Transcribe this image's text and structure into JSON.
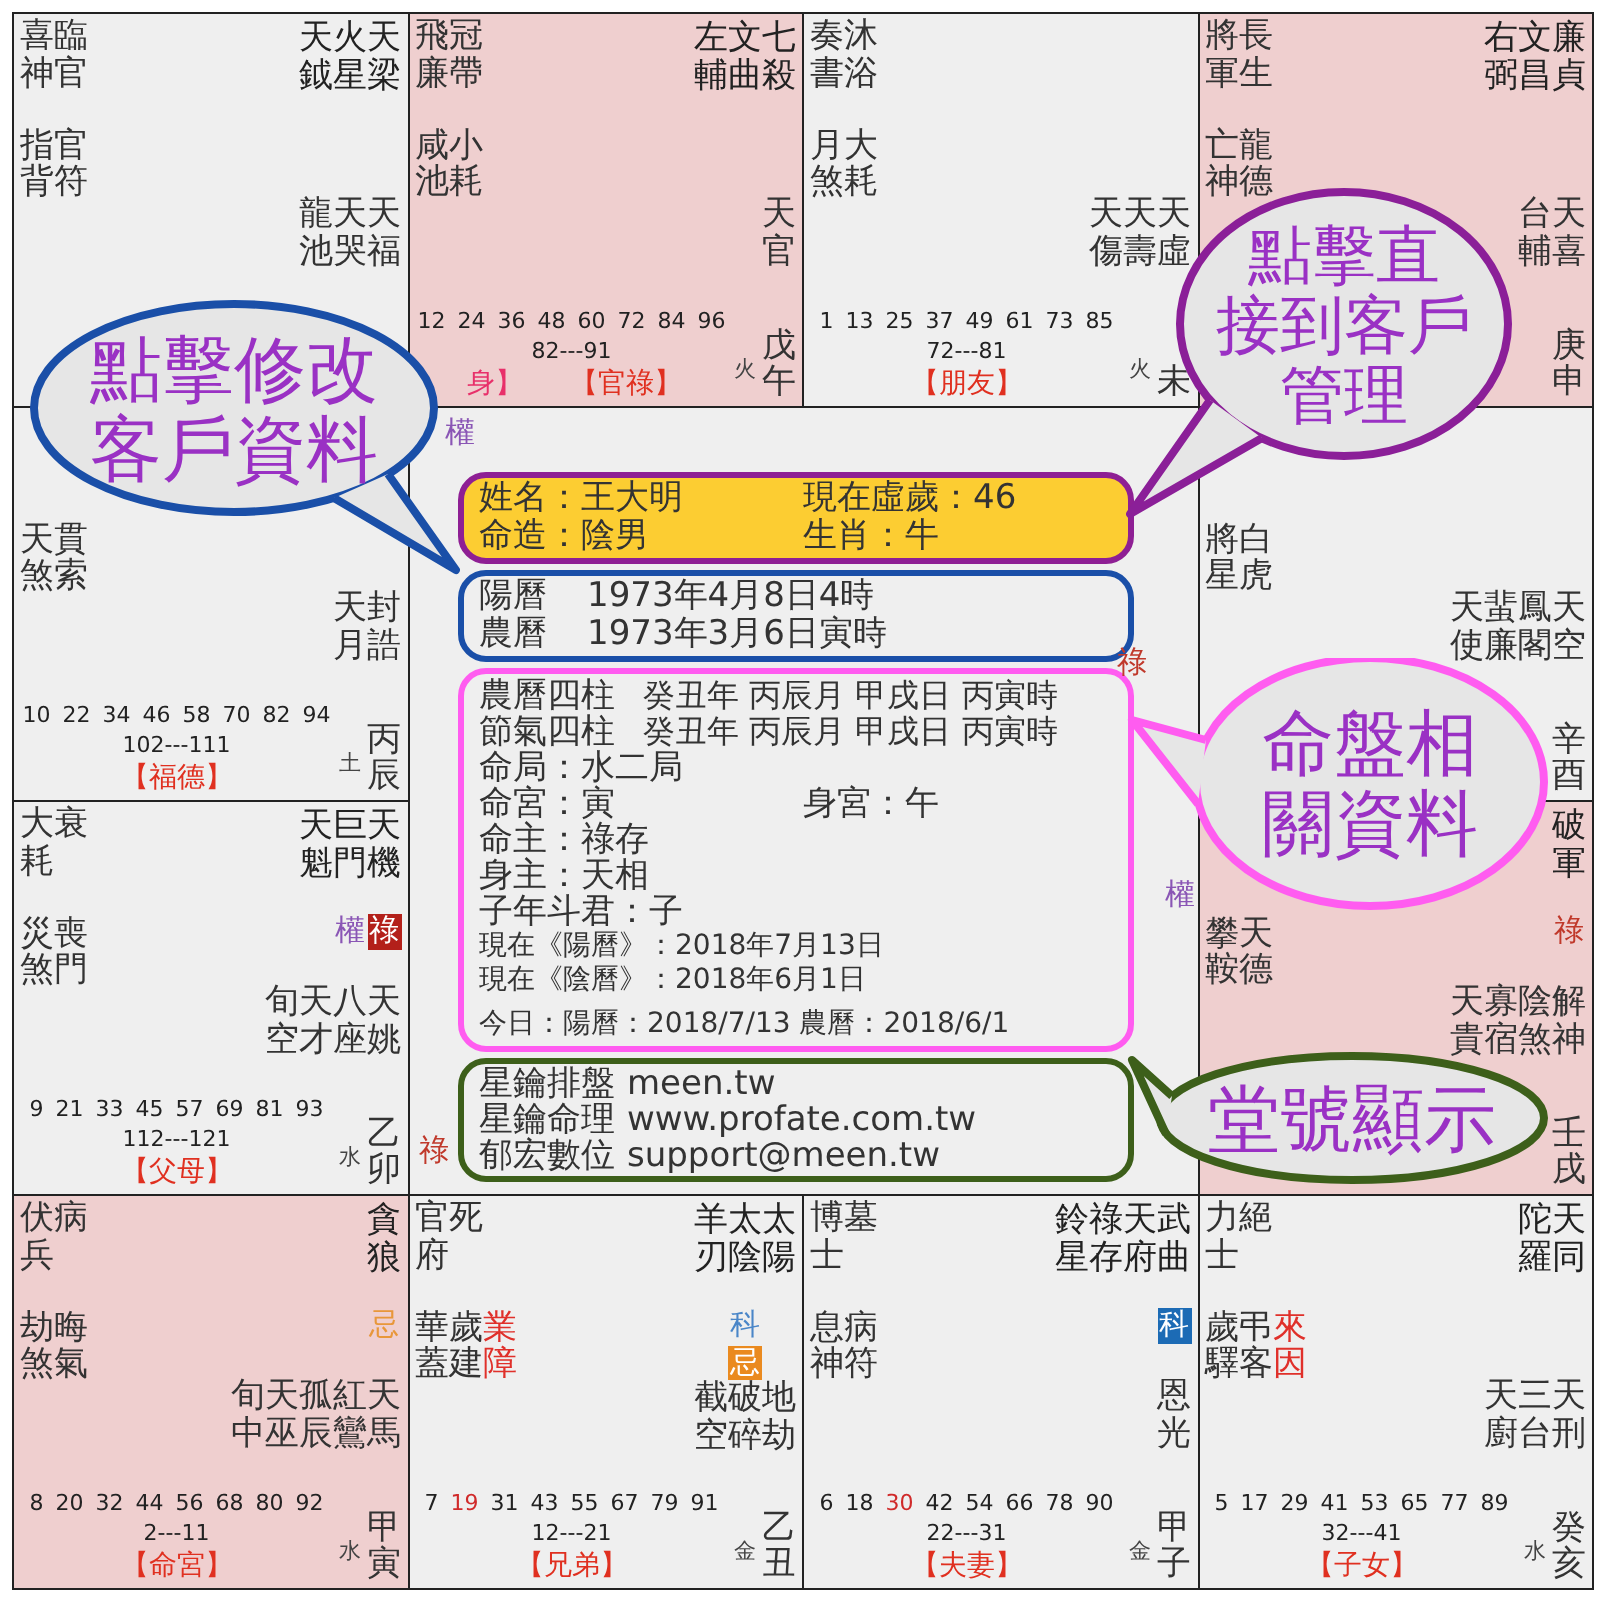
{
  "palaces": [
    {
      "highlighted": false,
      "minor_groups": [
        {
          "stars": [
            "喜神",
            "臨官"
          ]
        },
        {
          "stars": [
            "指背",
            "官符"
          ]
        }
      ],
      "main_stars": [
        {
          "name": "天鉞"
        },
        {
          "name": "火星"
        },
        {
          "name": "天梁"
        }
      ],
      "other_stars": [
        "龍池",
        "天哭",
        "天福"
      ]
    },
    {
      "highlighted": true,
      "minor_groups": [
        {
          "stars": [
            "飛廉",
            "冠帶"
          ]
        },
        {
          "stars": [
            "咸池",
            "小耗"
          ]
        }
      ],
      "main_stars": [
        {
          "name": "左輔"
        },
        {
          "name": "文曲"
        },
        {
          "name": "七殺"
        }
      ],
      "other_stars": [
        "天官"
      ],
      "ages": [
        "12",
        "24",
        "36",
        "48",
        "60",
        "72",
        "84",
        "96"
      ],
      "decade": "82---91",
      "body_mark": "身】",
      "name": "【官祿】",
      "element": "火",
      "stem_branch": "戊午"
    },
    {
      "highlighted": false,
      "minor_groups": [
        {
          "stars": [
            "奏書",
            "沐浴"
          ]
        },
        {
          "stars": [
            "月煞",
            "大耗"
          ]
        }
      ],
      "other_stars": [
        "天傷",
        "天壽",
        "天虛"
      ],
      "ages": [
        "1",
        "13",
        "25",
        "37",
        "49",
        "61",
        "73",
        "85"
      ],
      "decade": "72---81",
      "name": "【朋友】",
      "element": "火",
      "stem_branch": "未"
    },
    {
      "highlighted": true,
      "minor_groups": [
        {
          "stars": [
            "將軍",
            "長生"
          ]
        },
        {
          "stars": [
            "亡神",
            "龍德"
          ]
        }
      ],
      "main_stars": [
        {
          "name": "右弼"
        },
        {
          "name": "文昌"
        },
        {
          "name": "廉貞"
        }
      ],
      "other_stars": [
        "台輔",
        "天喜"
      ],
      "stem_branch": "庚申"
    },
    {
      "highlighted": false,
      "minor_groups": [
        {
          "stars": [
            "天煞",
            "貫索"
          ]
        }
      ],
      "other_stars": [
        "天月",
        "封誥"
      ],
      "ages": [
        "10",
        "22",
        "34",
        "46",
        "58",
        "70",
        "82",
        "94"
      ],
      "decade": "102---111",
      "name": "【福德】",
      "element": "土",
      "stem_branch": "丙辰"
    },
    {
      "highlighted": false,
      "minor_groups": [
        {
          "stars": [
            "將星",
            "白虎"
          ]
        }
      ],
      "other_stars": [
        "天使",
        "蜚廉",
        "鳳閣",
        "天空"
      ],
      "stem_branch": "辛酉"
    },
    {
      "highlighted": false,
      "minor_groups": [
        {
          "stars": [
            "大耗",
            "衰"
          ]
        },
        {
          "stars": [
            "災煞",
            "喪門"
          ]
        }
      ],
      "main_stars": [
        {
          "name": "天魁"
        },
        {
          "name": "巨門",
          "hua": [
            {
              "text": "權",
              "kind": "plain",
              "color": "#8a56b5"
            }
          ]
        },
        {
          "name": "天機",
          "hua": [
            {
              "text": "祿",
              "kind": "badge",
              "color": "#b3201a"
            }
          ]
        }
      ],
      "other_stars": [
        "旬空",
        "天才",
        "八座",
        "天姚"
      ],
      "ages": [
        "9",
        "21",
        "33",
        "45",
        "57",
        "69",
        "81",
        "93"
      ],
      "decade": "112---121",
      "name": "【父母】",
      "element": "水",
      "stem_branch": "乙卯"
    },
    {
      "highlighted": true,
      "minor_groups": [
        {
          "stars": [
            "攀鞍",
            "天德"
          ]
        }
      ],
      "main_stars": [
        {
          "name": "破軍",
          "hua": [
            {
              "text": "祿",
              "kind": "plain",
              "color": "#c0392b"
            }
          ]
        }
      ],
      "other_stars": [
        "天貴",
        "寡宿",
        "陰煞",
        "解神"
      ],
      "stem_branch": "壬戌"
    },
    {
      "highlighted": true,
      "minor_groups": [
        {
          "stars": [
            "伏兵",
            "病"
          ]
        },
        {
          "stars": [
            "劫煞",
            "晦氣"
          ]
        }
      ],
      "main_stars": [
        {
          "name": "貪狼",
          "hua": [
            {
              "text": "忌",
              "kind": "plain",
              "color": "#e8973a"
            }
          ]
        }
      ],
      "other_stars": [
        "旬中",
        "天巫",
        "孤辰",
        "紅鸞",
        "天馬"
      ],
      "ages": [
        "8",
        "20",
        "32",
        "44",
        "56",
        "68",
        "80",
        "92"
      ],
      "decade": "2---11",
      "name": "【命宮】",
      "element": "水",
      "stem_branch": "甲寅"
    },
    {
      "highlighted": false,
      "minor_groups": [
        {
          "stars": [
            "官府",
            "死"
          ]
        },
        {
          "stars": [
            "華蓋",
            "歲建"
          ],
          "tags": [
            "業障"
          ]
        }
      ],
      "main_stars": [
        {
          "name": "羊刃"
        },
        {
          "name": "太陰",
          "hua": [
            {
              "text": "科",
              "kind": "plain",
              "color": "#4a86c8"
            },
            {
              "text": "忌",
              "kind": "badge",
              "color": "#ea8a1f"
            }
          ]
        },
        {
          "name": "太陽"
        }
      ],
      "other_stars": [
        "截空",
        "破碎",
        "地劫"
      ],
      "ages": [
        {
          "text": "7",
          "highlighted": false
        },
        {
          "text": "19",
          "highlighted": true
        },
        {
          "text": "31",
          "highlighted": false
        },
        {
          "text": "43",
          "highlighted": false
        },
        {
          "text": "55",
          "highlighted": false
        },
        {
          "text": "67",
          "highlighted": false
        },
        {
          "text": "79",
          "highlighted": false
        },
        {
          "text": "91",
          "highlighted": false
        }
      ],
      "decade": "12---21",
      "name": "【兄弟】",
      "element": "金",
      "stem_branch": "乙丑"
    },
    {
      "highlighted": false,
      "minor_groups": [
        {
          "stars": [
            "博士",
            "墓"
          ]
        },
        {
          "stars": [
            "息神",
            "病符"
          ]
        }
      ],
      "main_stars": [
        {
          "name": "鈴星"
        },
        {
          "name": "祿存"
        },
        {
          "name": "天府"
        },
        {
          "name": "武曲",
          "hua": [
            {
              "text": "科",
              "kind": "badge",
              "color": "#1c6bb5"
            }
          ]
        }
      ],
      "other_stars": [
        "恩光"
      ],
      "ages": [
        {
          "text": "6",
          "highlighted": false
        },
        {
          "text": "18",
          "highlighted": false
        },
        {
          "text": "30",
          "highlighted": true
        },
        {
          "text": "42",
          "highlighted": false
        },
        {
          "text": "54",
          "highlighted": false
        },
        {
          "text": "66",
          "highlighted": false
        },
        {
          "text": "78",
          "highlighted": false
        },
        {
          "text": "90",
          "highlighted": false
        }
      ],
      "decade": "22---31",
      "name": "【夫妻】",
      "element": "金",
      "stem_branch": "甲子"
    },
    {
      "highlighted": false,
      "minor_groups": [
        {
          "stars": [
            "力士",
            "絕"
          ]
        },
        {
          "stars": [
            "歲驛",
            "弔客"
          ],
          "tags": [
            "來因"
          ]
        }
      ],
      "main_stars": [
        {
          "name": "陀羅"
        },
        {
          "name": "天同"
        }
      ],
      "other_stars": [
        "天廚",
        "三台",
        "天刑"
      ],
      "ages": [
        "5",
        "17",
        "29",
        "41",
        "53",
        "65",
        "77",
        "89"
      ],
      "decade": "32---41",
      "name": "【子女】",
      "element": "水",
      "stem_branch": "癸亥"
    }
  ],
  "center": {
    "marks": [
      {
        "text": "權",
        "color": "#8a56b5"
      },
      {
        "text": "祿",
        "color": "#c0392b"
      },
      {
        "text": "權",
        "color": "#8a56b5"
      },
      {
        "text": "祿",
        "color": "#c0392b"
      }
    ],
    "profile": [
      "姓名：王大明",
      "現在虛歲：46",
      "命造：陰男",
      "生肖：牛"
    ],
    "birth": [
      {
        "label": "陽曆",
        "value": "1973年4月8日4時"
      },
      {
        "label": "農曆",
        "value": "1973年3月6日寅時"
      }
    ],
    "pillars": [
      {
        "label": "農曆四柱",
        "value": "癸丑年 丙辰月 甲戌日 丙寅時"
      },
      {
        "label": "節氣四柱",
        "value": "癸丑年 丙辰月 甲戌日 丙寅時"
      }
    ],
    "details": [
      [
        "命局：水二局"
      ],
      [
        "命宮：寅",
        "身宮：午"
      ],
      [
        "命主：祿存"
      ],
      [
        "身主：天相"
      ],
      [
        "子年斗君：子"
      ]
    ],
    "dates": [
      "現在《陽曆》：2018年7月13日",
      "現在《陰曆》：2018年6月1日",
      "今日：陽曆：2018/7/13 農曆：2018/6/1"
    ],
    "studio": [
      {
        "name": "星鑰排盤",
        "contact": "meen.tw"
      },
      {
        "name": "星鑰命理",
        "contact": "www.profate.com.tw"
      },
      {
        "name": "郁宏數位",
        "contact": "support@meen.tw"
      }
    ]
  },
  "bubbles": [
    {
      "lines": [
        "點擊修改",
        "客戶資料"
      ],
      "color": "#1a4fa8"
    },
    {
      "lines": [
        "點擊直",
        "接到客戶",
        "管理"
      ],
      "color": "#8b1f98"
    },
    {
      "lines": [
        "命盤相",
        "關資料"
      ],
      "color": "#ff5cf0"
    },
    {
      "lines": [
        "堂號顯示"
      ],
      "color": "#3d5f1a"
    }
  ]
}
